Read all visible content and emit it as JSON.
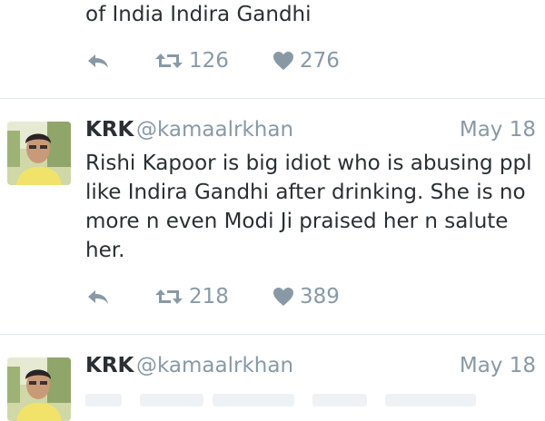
{
  "tweet1": {
    "text_tail": "of India Indira Gandhi",
    "retweet_count": "126",
    "like_count": "276"
  },
  "tweet2": {
    "name": "KRK",
    "handle": "@kamaalrkhan",
    "time": "May 18",
    "lines": [
      "Rishi Kapoor is big idiot who is abusing ppl",
      "like Indira Gandhi after drinking. She is no",
      "more n even Modi Ji praised her n salute",
      "her."
    ],
    "retweet_count": "218",
    "like_count": "389"
  },
  "tweet3": {
    "name": "KRK",
    "handle": "@kamaalrkhan",
    "time": "May 18"
  },
  "icons": {
    "reply": "reply-icon",
    "retweet": "retweet-icon",
    "like": "heart-icon"
  },
  "colors": {
    "text": "#292f33",
    "muted": "#8899a6",
    "divider": "#e1e8ed"
  }
}
